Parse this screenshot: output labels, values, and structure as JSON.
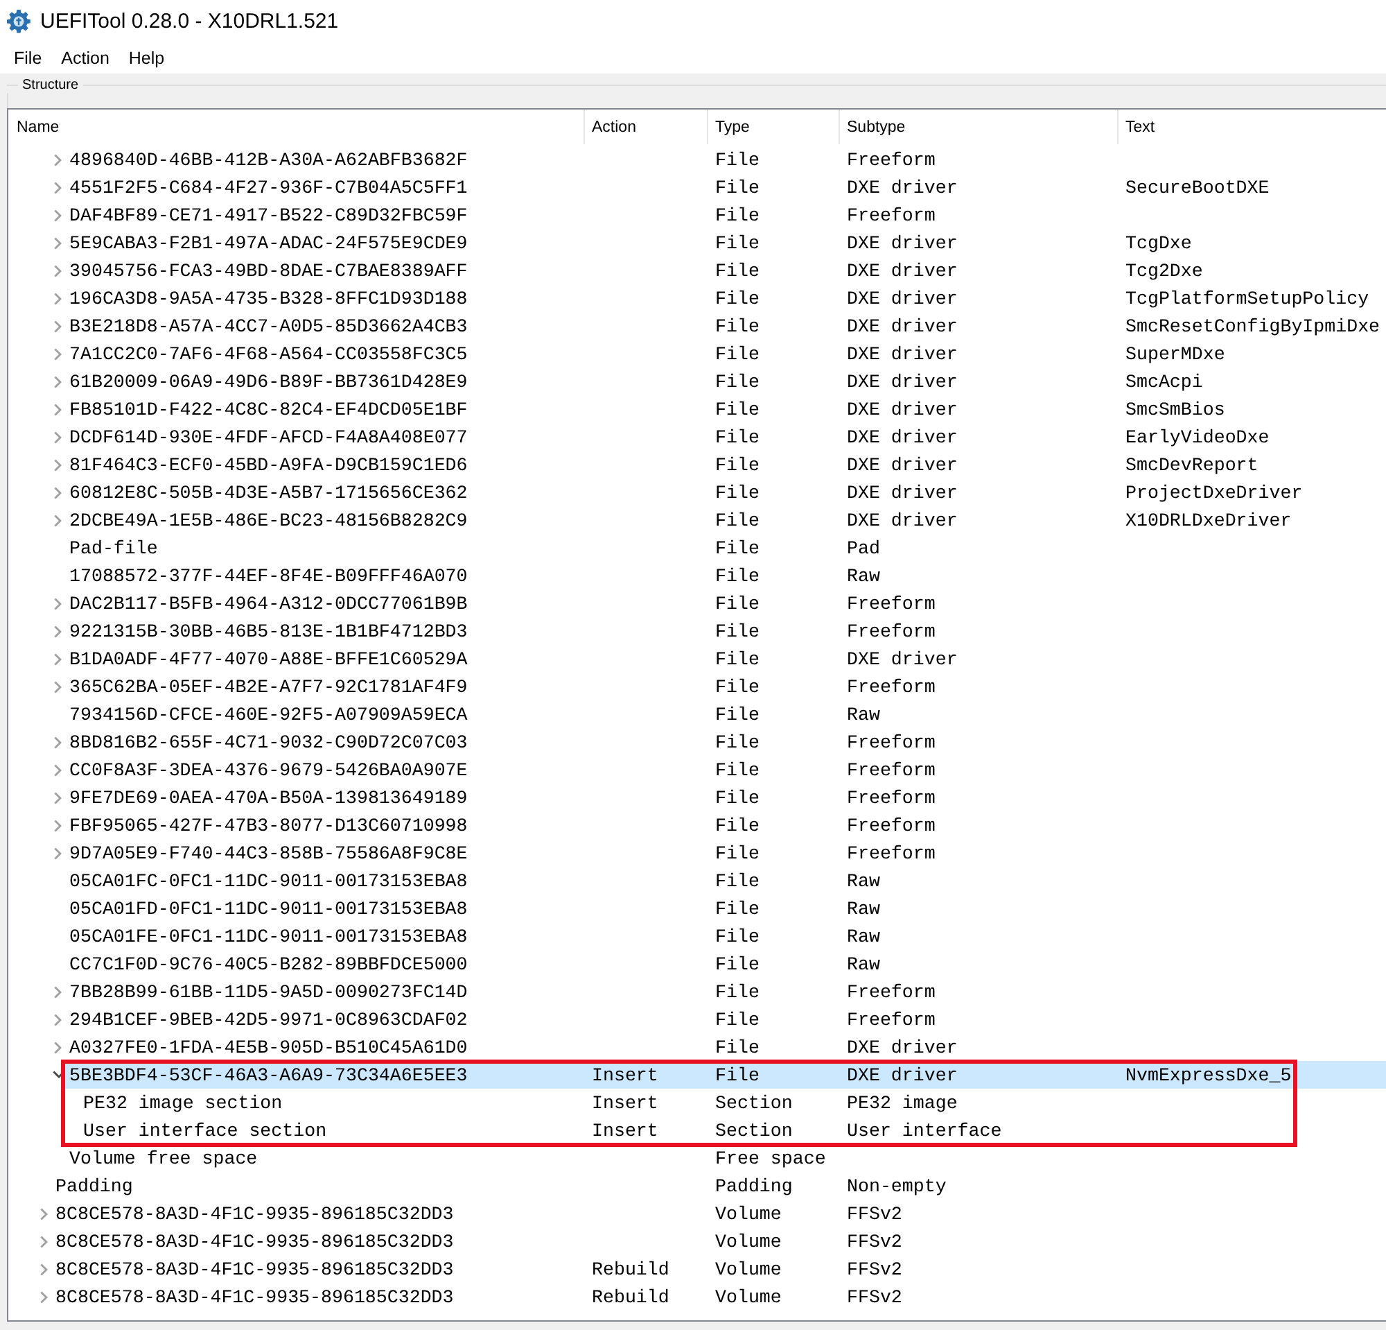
{
  "window": {
    "title": "UEFITool 0.28.0 - X10DRL1.521"
  },
  "menu": [
    "File",
    "Action",
    "Help"
  ],
  "group": {
    "title": "Structure"
  },
  "tree": {
    "columns": [
      "Name",
      "Action",
      "Type",
      "Subtype",
      "Text"
    ],
    "volume_contents": [
      {
        "name": "4896840D-46BB-412B-A30A-A62ABFB3682F",
        "type": "File",
        "subtype": "Freeform",
        "expanded": false,
        "selected": false,
        "boxed": false
      },
      {
        "name": "4551F2F5-C684-4F27-936F-C7B04A5C5FF1",
        "type": "File",
        "subtype": "DXE driver",
        "text": "SecureBootDXE",
        "expanded": false,
        "selected": false,
        "boxed": false
      },
      {
        "name": "DAF4BF89-CE71-4917-B522-C89D32FBC59F",
        "type": "File",
        "subtype": "Freeform",
        "expanded": false,
        "selected": false,
        "boxed": false
      },
      {
        "name": "5E9CABA3-F2B1-497A-ADAC-24F575E9CDE9",
        "type": "File",
        "subtype": "DXE driver",
        "text": "TcgDxe",
        "expanded": false,
        "selected": false,
        "boxed": false
      },
      {
        "name": "39045756-FCA3-49BD-8DAE-C7BAE8389AFF",
        "type": "File",
        "subtype": "DXE driver",
        "text": "Tcg2Dxe",
        "expanded": false,
        "selected": false,
        "boxed": false
      },
      {
        "name": "196CA3D8-9A5A-4735-B328-8FFC1D93D188",
        "type": "File",
        "subtype": "DXE driver",
        "text": "TcgPlatformSetupPolicy",
        "expanded": false,
        "selected": false,
        "boxed": false
      },
      {
        "name": "B3E218D8-A57A-4CC7-A0D5-85D3662A4CB3",
        "type": "File",
        "subtype": "DXE driver",
        "text": "SmcResetConfigByIpmiDxe",
        "expanded": false,
        "selected": false,
        "boxed": false
      },
      {
        "name": "7A1CC2C0-7AF6-4F68-A564-CC03558FC3C5",
        "type": "File",
        "subtype": "DXE driver",
        "text": "SuperMDxe",
        "expanded": false,
        "selected": false,
        "boxed": false
      },
      {
        "name": "61B20009-06A9-49D6-B89F-BB7361D428E9",
        "type": "File",
        "subtype": "DXE driver",
        "text": "SmcAcpi",
        "expanded": false,
        "selected": false,
        "boxed": false
      },
      {
        "name": "FB85101D-F422-4C8C-82C4-EF4DCD05E1BF",
        "type": "File",
        "subtype": "DXE driver",
        "text": "SmcSmBios",
        "expanded": false,
        "selected": false,
        "boxed": false
      },
      {
        "name": "DCDF614D-930E-4FDF-AFCD-F4A8A408E077",
        "type": "File",
        "subtype": "DXE driver",
        "text": "EarlyVideoDxe",
        "expanded": false,
        "selected": false,
        "boxed": false
      },
      {
        "name": "81F464C3-ECF0-45BD-A9FA-D9CB159C1ED6",
        "type": "File",
        "subtype": "DXE driver",
        "text": "SmcDevReport",
        "expanded": false,
        "selected": false,
        "boxed": false
      },
      {
        "name": "60812E8C-505B-4D3E-A5B7-1715656CE362",
        "type": "File",
        "subtype": "DXE driver",
        "text": "ProjectDxeDriver",
        "expanded": false,
        "selected": false,
        "boxed": false
      },
      {
        "name": "2DCBE49A-1E5B-486E-BC23-48156B8282C9",
        "type": "File",
        "subtype": "DXE driver",
        "text": "X10DRLDxeDriver",
        "expanded": false,
        "selected": false,
        "boxed": false
      },
      {
        "name": "Pad-file",
        "type": "File",
        "subtype": "Pad",
        "selected": false,
        "boxed": false
      },
      {
        "name": "17088572-377F-44EF-8F4E-B09FFF46A070",
        "type": "File",
        "subtype": "Raw",
        "selected": false,
        "boxed": false
      },
      {
        "name": "DAC2B117-B5FB-4964-A312-0DCC77061B9B",
        "type": "File",
        "subtype": "Freeform",
        "expanded": false,
        "selected": false,
        "boxed": false
      },
      {
        "name": "9221315B-30BB-46B5-813E-1B1BF4712BD3",
        "type": "File",
        "subtype": "Freeform",
        "expanded": false,
        "selected": false,
        "boxed": false
      },
      {
        "name": "B1DA0ADF-4F77-4070-A88E-BFFE1C60529A",
        "type": "File",
        "subtype": "DXE driver",
        "expanded": false,
        "selected": false,
        "boxed": false
      },
      {
        "name": "365C62BA-05EF-4B2E-A7F7-92C1781AF4F9",
        "type": "File",
        "subtype": "Freeform",
        "expanded": false,
        "selected": false,
        "boxed": false
      },
      {
        "name": "7934156D-CFCE-460E-92F5-A07909A59ECA",
        "type": "File",
        "subtype": "Raw",
        "selected": false,
        "boxed": false
      },
      {
        "name": "8BD816B2-655F-4C71-9032-C90D72C07C03",
        "type": "File",
        "subtype": "Freeform",
        "expanded": false,
        "selected": false,
        "boxed": false
      },
      {
        "name": "CC0F8A3F-3DEA-4376-9679-5426BA0A907E",
        "type": "File",
        "subtype": "Freeform",
        "expanded": false,
        "selected": false,
        "boxed": false
      },
      {
        "name": "9FE7DE69-0AEA-470A-B50A-139813649189",
        "type": "File",
        "subtype": "Freeform",
        "expanded": false,
        "selected": false,
        "boxed": false
      },
      {
        "name": "FBF95065-427F-47B3-8077-D13C60710998",
        "type": "File",
        "subtype": "Freeform",
        "expanded": false,
        "selected": false,
        "boxed": false
      },
      {
        "name": "9D7A05E9-F740-44C3-858B-75586A8F9C8E",
        "type": "File",
        "subtype": "Freeform",
        "expanded": false,
        "selected": false,
        "boxed": false
      },
      {
        "name": "05CA01FC-0FC1-11DC-9011-00173153EBA8",
        "type": "File",
        "subtype": "Raw",
        "selected": false,
        "boxed": false
      },
      {
        "name": "05CA01FD-0FC1-11DC-9011-00173153EBA8",
        "type": "File",
        "subtype": "Raw",
        "selected": false,
        "boxed": false
      },
      {
        "name": "05CA01FE-0FC1-11DC-9011-00173153EBA8",
        "type": "File",
        "subtype": "Raw",
        "selected": false,
        "boxed": false
      },
      {
        "name": "CC7C1F0D-9C76-40C5-B282-89BBFDCE5000",
        "type": "File",
        "subtype": "Raw",
        "selected": false,
        "boxed": false
      },
      {
        "name": "7BB28B99-61BB-11D5-9A5D-0090273FC14D",
        "type": "File",
        "subtype": "Freeform",
        "expanded": false,
        "selected": false,
        "boxed": false
      },
      {
        "name": "294B1CEF-9BEB-42D5-9971-0C8963CDAF02",
        "type": "File",
        "subtype": "Freeform",
        "expanded": false,
        "selected": false,
        "boxed": false
      },
      {
        "name": "A0327FE0-1FDA-4E5B-905D-B510C45A61D0",
        "type": "File",
        "subtype": "DXE driver",
        "expanded": false,
        "selected": false,
        "boxed": false
      },
      {
        "name": "5BE3BDF4-53CF-46A3-A6A9-73C34A6E5EE3",
        "action": "Insert",
        "type": "File",
        "subtype": "DXE driver",
        "text": "NvmExpressDxe_5",
        "expanded": true,
        "selected": true,
        "boxed": true,
        "children": [
          {
            "name": "PE32 image section",
            "action": "Insert",
            "type": "Section",
            "subtype": "PE32 image",
            "selected": false,
            "boxed": true
          },
          {
            "name": "User interface section",
            "action": "Insert",
            "type": "Section",
            "subtype": "User interface",
            "selected": false,
            "boxed": true
          }
        ]
      },
      {
        "name": "Volume free space",
        "type": "Free space",
        "selected": false,
        "boxed": false
      }
    ],
    "rows": [
      {
        "name": "Padding",
        "type": "Padding",
        "subtype": "Non-empty",
        "selected": false,
        "boxed": false
      },
      {
        "name": "8C8CE578-8A3D-4F1C-9935-896185C32DD3",
        "type": "Volume",
        "subtype": "FFSv2",
        "expanded": false,
        "selected": false,
        "boxed": false
      },
      {
        "name": "8C8CE578-8A3D-4F1C-9935-896185C32DD3",
        "type": "Volume",
        "subtype": "FFSv2",
        "expanded": false,
        "selected": false,
        "boxed": false
      },
      {
        "name": "8C8CE578-8A3D-4F1C-9935-896185C32DD3",
        "action": "Rebuild",
        "type": "Volume",
        "subtype": "FFSv2",
        "expanded": false,
        "selected": false,
        "boxed": false
      },
      {
        "name": "8C8CE578-8A3D-4F1C-9935-896185C32DD3",
        "action": "Rebuild",
        "type": "Volume",
        "subtype": "FFSv2",
        "expanded": false,
        "selected": false,
        "boxed": false
      }
    ]
  }
}
